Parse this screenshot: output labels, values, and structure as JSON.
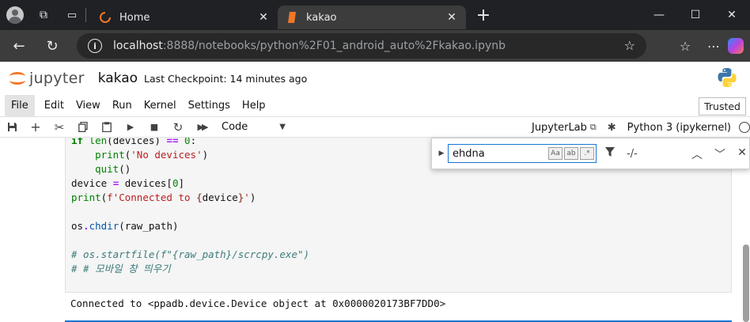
{
  "browser": {
    "tabs": [
      {
        "title": "Home",
        "active": false
      },
      {
        "title": "kakao",
        "active": true
      }
    ],
    "url_host": "localhost",
    "url_rest": ":8888/notebooks/python%2F01_android_auto%2Fkakao.ipynb"
  },
  "jupyter": {
    "logo_text": "jupyter",
    "notebook_name": "kakao",
    "checkpoint": "Last Checkpoint: 14 minutes ago",
    "menu": [
      "File",
      "Edit",
      "View",
      "Run",
      "Kernel",
      "Settings",
      "Help"
    ],
    "trusted": "Trusted",
    "cell_type": "Code",
    "jupyterlab_link": "JupyterLab",
    "kernel_name": "Python 3 (ipykernel)"
  },
  "find": {
    "query": "ehdna",
    "count": "-/-",
    "opt_case": "Aa",
    "opt_word": "ab",
    "opt_regex": ".*"
  },
  "output": {
    "text": "Connected to <ppadb.device.Device object at 0x0000020173BF7DD0>"
  },
  "colors": {
    "accent": "#1976d2",
    "jupyter_orange": "#f37726"
  }
}
